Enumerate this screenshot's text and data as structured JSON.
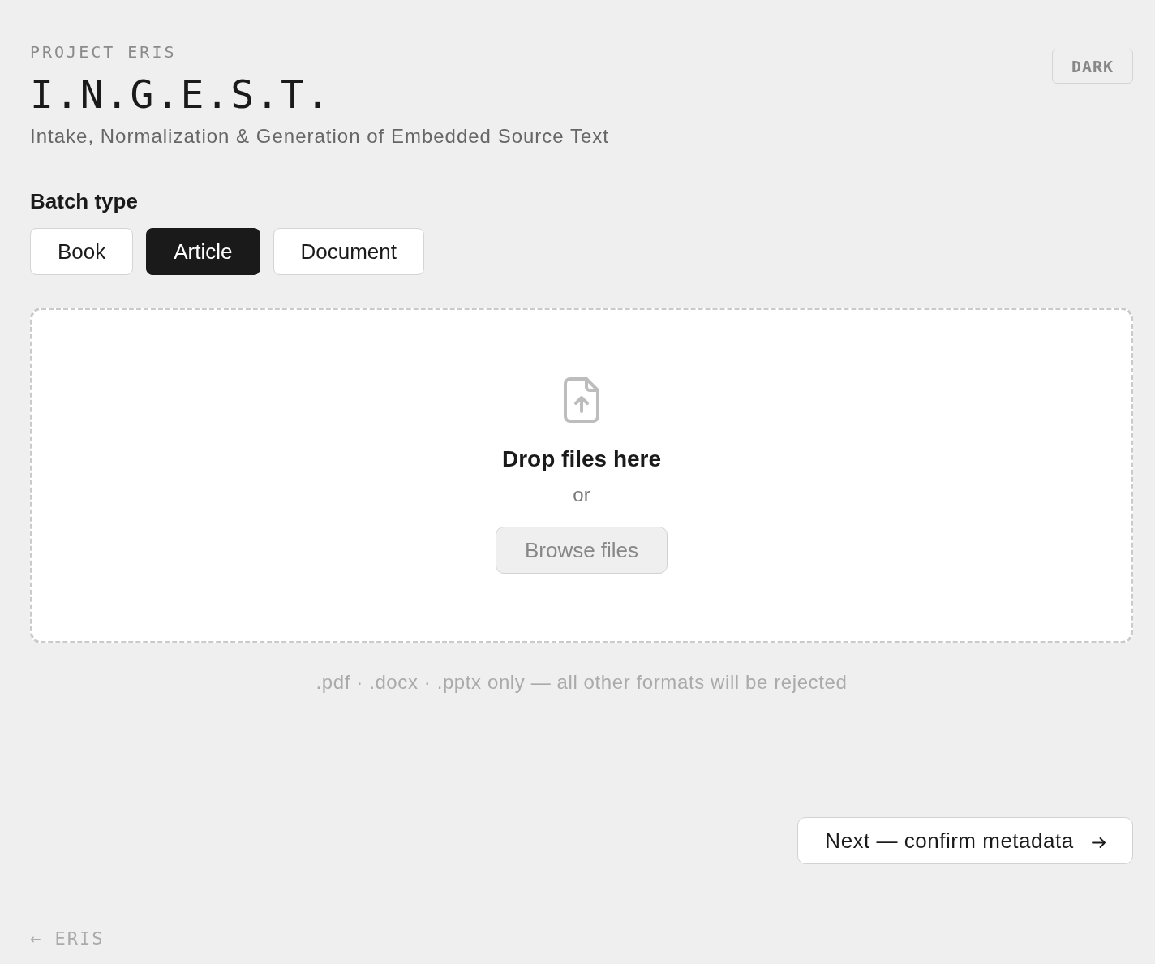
{
  "header": {
    "eyebrow": "PROJECT ERIS",
    "title": "I.N.G.E.S.T.",
    "subtitle": "Intake, Normalization & Generation of Embedded Source Text",
    "theme_toggle": "DARK"
  },
  "batch_type": {
    "label": "Batch type",
    "options": [
      {
        "label": "Book",
        "selected": false
      },
      {
        "label": "Article",
        "selected": true
      },
      {
        "label": "Document",
        "selected": false
      }
    ]
  },
  "dropzone": {
    "heading": "Drop files here",
    "separator": "or",
    "browse_button": "Browse files"
  },
  "hint": ".pdf · .docx · .pptx only — all other formats will be rejected",
  "next_button": "Next — confirm metadata",
  "footer": {
    "back_link": "← ERIS"
  }
}
